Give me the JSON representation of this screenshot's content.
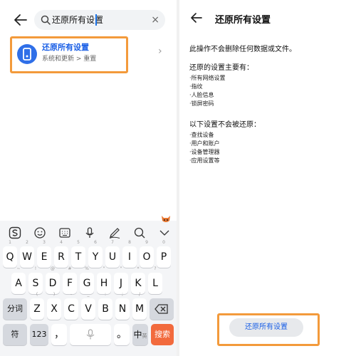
{
  "search": {
    "query": "还原所有设置",
    "clear_icon": "×",
    "result": {
      "title": "还原所有设置",
      "subtitle": "系统和更新 > 重置",
      "chevron": "›",
      "icon": "phone-reset-icon"
    }
  },
  "keyboard": {
    "toolbar": [
      "s-logo-icon",
      "emoji-icon",
      "keyboard-icon",
      "mic-icon",
      "handwriting-icon",
      "search-icon",
      "collapse-icon"
    ],
    "row1": [
      {
        "key": "Q",
        "hint": "1"
      },
      {
        "key": "W",
        "hint": "2"
      },
      {
        "key": "E",
        "hint": "3"
      },
      {
        "key": "R",
        "hint": "4"
      },
      {
        "key": "T",
        "hint": "5"
      },
      {
        "key": "Y",
        "hint": "6"
      },
      {
        "key": "U",
        "hint": "7"
      },
      {
        "key": "I",
        "hint": "8"
      },
      {
        "key": "O",
        "hint": "9"
      },
      {
        "key": "P",
        "hint": "0"
      }
    ],
    "row2": [
      {
        "key": "A",
        "hint": "~"
      },
      {
        "key": "S",
        "hint": "!"
      },
      {
        "key": "D",
        "hint": "@"
      },
      {
        "key": "F",
        "hint": "#"
      },
      {
        "key": "G",
        "hint": "%"
      },
      {
        "key": "H",
        "hint": "\""
      },
      {
        "key": "J",
        "hint": "\""
      },
      {
        "key": "K",
        "hint": "*"
      },
      {
        "key": "L",
        "hint": "?"
      }
    ],
    "row3": [
      {
        "key": "Z",
        "hint": "("
      },
      {
        "key": "X",
        "hint": ")"
      },
      {
        "key": "C",
        "hint": "-"
      },
      {
        "key": "V",
        "hint": "_"
      },
      {
        "key": "B",
        "hint": ":"
      },
      {
        "key": "N",
        "hint": ";"
      },
      {
        "key": "M",
        "hint": "/"
      }
    ],
    "fenci": "分词",
    "fu": "符",
    "num": "123",
    "comma": "，",
    "period": "。",
    "lang_main": "中",
    "lang_sub": "英",
    "search_key": "搜索"
  },
  "reset_page": {
    "title": "还原所有设置",
    "warning": "此操作不会删除任何数据或文件。",
    "restore_heading": "还原的设置主要有：",
    "restore_items": [
      "·所有网络设置",
      "·指纹",
      "·人脸信息",
      "·锁屏密码"
    ],
    "keep_heading": "以下设置不会被还原：",
    "keep_items": [
      "·查找设备",
      "·用户和账户",
      "·设备管理器",
      "·应用设置等"
    ],
    "button_label": "还原所有设置"
  },
  "colors": {
    "highlight": "#f39a3b",
    "accent": "#1a5fe6",
    "search_key": "#f26a3d"
  }
}
